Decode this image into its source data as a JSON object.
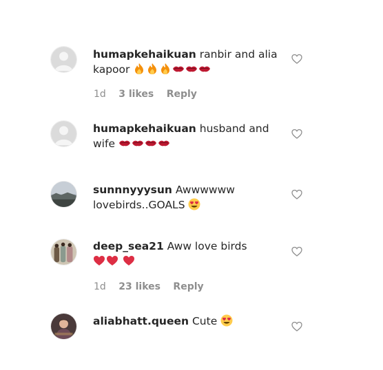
{
  "comments": [
    {
      "username": "humapkehaikuan",
      "text": "ranbir and alia kapoor",
      "emojis": [
        "fire-emoji",
        "fire-emoji",
        "fire-emoji",
        "lips-emoji",
        "lips-emoji",
        "lips-emoji"
      ],
      "time": "1d",
      "likes": "3 likes",
      "reply": "Reply"
    },
    {
      "username": "humapkehaikuan",
      "text": "husband and wife",
      "emojis": [
        "lips-emoji",
        "lips-emoji",
        "lips-emoji",
        "lips-emoji"
      ]
    },
    {
      "username": "sunnnyyysun",
      "text": "Awwwwww lovebirds..GOALS",
      "emojis": [
        "heart-eyes-emoji"
      ]
    },
    {
      "username": "deep_sea21",
      "text": "Aww love birds",
      "emojis": [
        "red-heart-emoji",
        "red-heart-emoji",
        "red-heart-emoji"
      ],
      "time": "1d",
      "likes": "23 likes",
      "reply": "Reply"
    },
    {
      "username": "aliabhatt.queen",
      "text": "Cute",
      "emojis": [
        "heart-eyes-emoji"
      ]
    }
  ],
  "colors": {
    "text": "#262626",
    "meta": "#8e8e8e",
    "heart_outline": "#8e8e8e"
  }
}
